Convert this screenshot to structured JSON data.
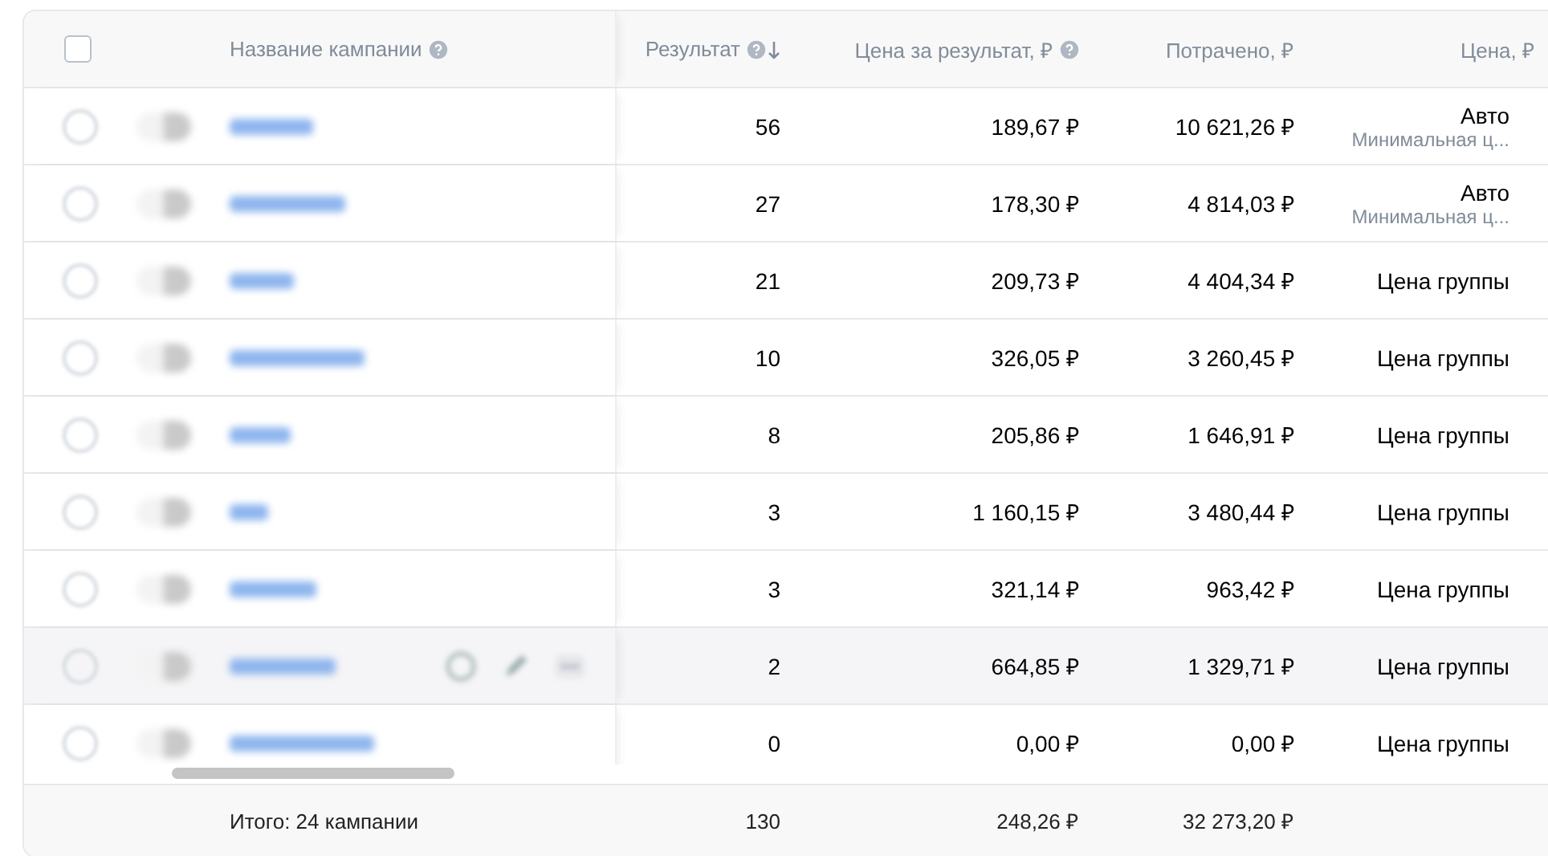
{
  "table": {
    "select_all_checked": false,
    "columns": [
      {
        "kind": "name",
        "label": "Название кампании",
        "icons": [
          {
            "kind": "help"
          }
        ]
      },
      {
        "kind": "num",
        "label": "Результат",
        "icons": [
          {
            "kind": "help"
          },
          {
            "kind": "sort_down"
          }
        ]
      },
      {
        "kind": "num",
        "label": "Цена за результат, ₽",
        "icons": [
          {
            "kind": "help"
          }
        ]
      },
      {
        "kind": "num",
        "label": "Потрачено, ₽"
      },
      {
        "kind": "num",
        "label": "Цена, ₽"
      }
    ],
    "rows": [
      {
        "highlighted": false,
        "result": "56",
        "cost_per_result": "189,67 ₽",
        "spent": "10 621,26 ₽",
        "price": "Авто",
        "price_note": "Минимальная ц..."
      },
      {
        "highlighted": false,
        "result": "27",
        "cost_per_result": "178,30 ₽",
        "spent": "4 814,03 ₽",
        "price": "Авто",
        "price_note": "Минимальная ц..."
      },
      {
        "highlighted": false,
        "result": "21",
        "cost_per_result": "209,73 ₽",
        "spent": "4 404,34 ₽",
        "price": "Цена группы"
      },
      {
        "highlighted": false,
        "result": "10",
        "cost_per_result": "326,05 ₽",
        "spent": "3 260,45 ₽",
        "price": "Цена группы"
      },
      {
        "highlighted": false,
        "result": "8",
        "cost_per_result": "205,86 ₽",
        "spent": "1 646,91 ₽",
        "price": "Цена группы"
      },
      {
        "highlighted": false,
        "result": "3",
        "cost_per_result": "1 160,15 ₽",
        "spent": "3 480,44 ₽",
        "price": "Цена группы"
      },
      {
        "highlighted": false,
        "result": "3",
        "cost_per_result": "321,14 ₽",
        "spent": "963,42 ₽",
        "price": "Цена группы"
      },
      {
        "highlighted": true,
        "result": "2",
        "cost_per_result": "664,85 ₽",
        "spent": "1 329,71 ₽",
        "price": "Цена группы"
      },
      {
        "highlighted": false,
        "result": "0",
        "cost_per_result": "0,00 ₽",
        "spent": "0,00 ₽",
        "price": "Цена группы"
      }
    ],
    "footer": {
      "label": "Итого: 24 кампании",
      "result": "130",
      "cost_per_result": "248,26 ₽",
      "spent": "32 273,20 ₽"
    }
  }
}
